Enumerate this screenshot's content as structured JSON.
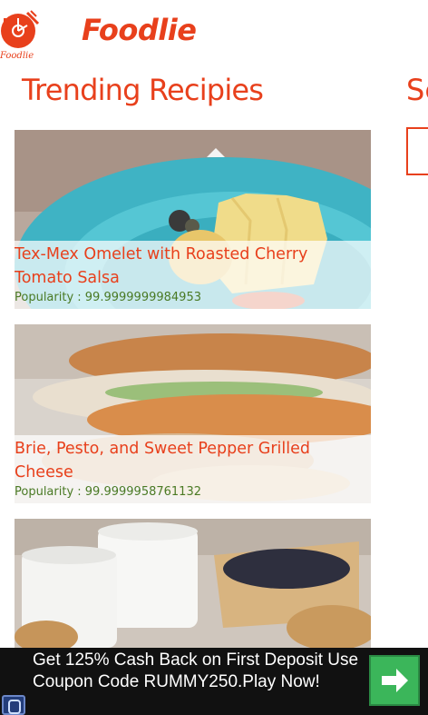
{
  "header": {
    "logo_caption": "Foodlie",
    "app_title": "Foodlie"
  },
  "sections": [
    {
      "title": "Trending Recipies"
    },
    {
      "title": "Se"
    }
  ],
  "recipes": [
    {
      "title": "Tex-Mex Omelet with Roasted Cherry Tomato Salsa",
      "popularity": "Popularity : 99.9999999984953"
    },
    {
      "title": "Brie, Pesto, and Sweet Pepper Grilled Cheese",
      "popularity": "Popularity : 99.9999958761132"
    }
  ],
  "ad": {
    "text": "Get 125% Cash Back on First Deposit Use Coupon Code RUMMY250.Play Now!",
    "button_icon": "arrow-right-icon",
    "badge_icon": "ad-badge-icon"
  },
  "colors": {
    "accent": "#e8401c",
    "popularity": "#4a7a25",
    "ad_background": "#111111",
    "ad_button": "#3bb65a"
  }
}
